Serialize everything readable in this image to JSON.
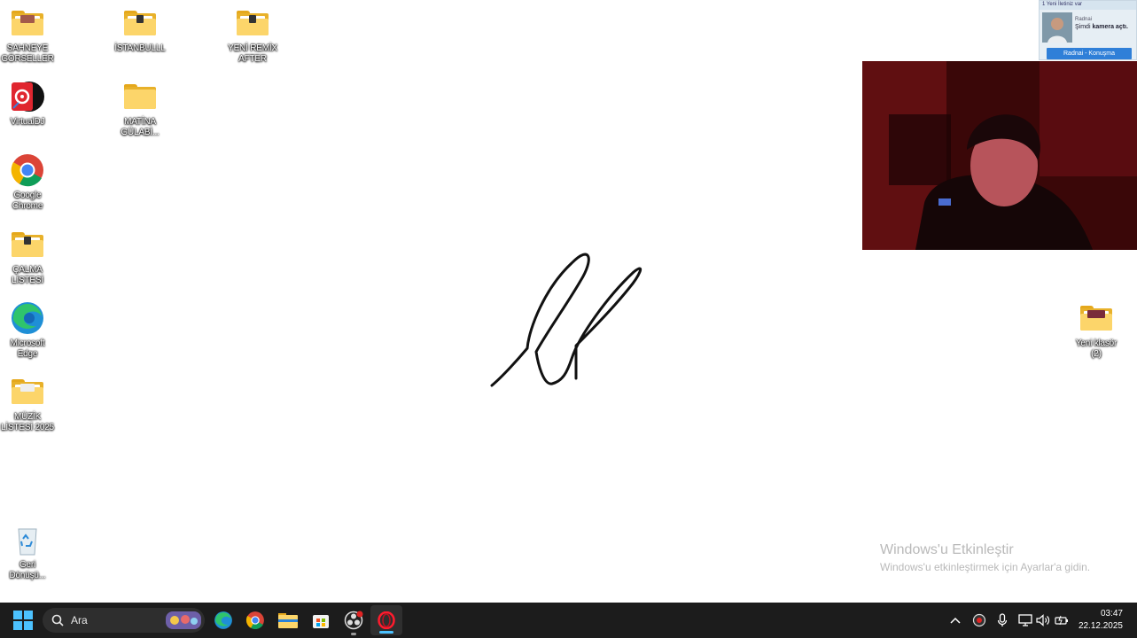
{
  "desktop": {
    "icons": [
      {
        "label": "SAHNEYE\nGÖRSELLER",
        "type": "folder"
      },
      {
        "label": "İSTANBULLL",
        "type": "folder"
      },
      {
        "label": "YENİ REMİX\nAFTER",
        "type": "folder"
      },
      {
        "label": "VirtualDJ",
        "type": "app"
      },
      {
        "label": "MATİNA\nGÜLABİ...",
        "type": "folder"
      },
      {
        "label": "Google\nChrome",
        "type": "app"
      },
      {
        "label": "ÇALMA\nLİSTESİ",
        "type": "folder"
      },
      {
        "label": "Microsoft\nEdge",
        "type": "app"
      },
      {
        "label": "MÜZİK\nLİSTESİ 2025",
        "type": "folder"
      },
      {
        "label": "Geri\nDönüşü...",
        "type": "recycle-bin"
      },
      {
        "label": "Yeni klasör\n(2)",
        "type": "folder"
      }
    ]
  },
  "notification": {
    "header": "1 Yeni İletiniz var",
    "sender": "Radnai",
    "message_prefix": "Şimdi",
    "message_bold": "kamera açtı.",
    "button": "Radnai - Konuşma"
  },
  "watermark": {
    "title": "Windows'u Etkinleştir",
    "subtitle": "Windows'u etkinleştirmek için Ayarlar'a gidin."
  },
  "taskbar": {
    "search_placeholder": "Ara",
    "time": "03:47",
    "date": "22.12.2025",
    "pinned": [
      "start-icon",
      "edge-icon",
      "chrome-icon",
      "file-explorer-icon",
      "store-icon",
      "obs-icon",
      "opera-icon"
    ],
    "tray": [
      "chevron-up-icon",
      "recording-icon",
      "microphone-icon",
      "network-icon",
      "volume-icon",
      "battery-icon"
    ]
  },
  "colors": {
    "taskbar": "#1c1c1c",
    "folder": "#fcd56a",
    "accent": "#4cc2ff",
    "notification_button": "#2f7fd8"
  }
}
